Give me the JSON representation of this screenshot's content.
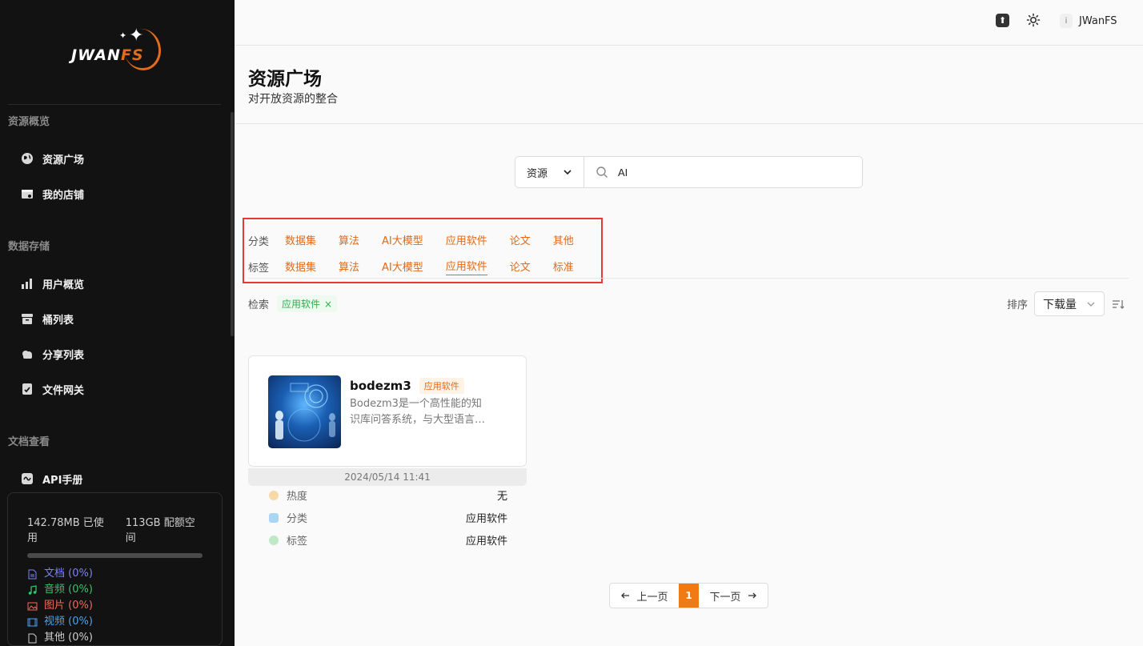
{
  "brand": {
    "logo_main": "JWAN",
    "logo_accent": "FS"
  },
  "sidebar": {
    "sections": [
      {
        "title": "资源概览",
        "items": [
          {
            "label": "资源广场",
            "icon": "globe-icon"
          },
          {
            "label": "我的店铺",
            "icon": "store-icon"
          }
        ]
      },
      {
        "title": "数据存储",
        "items": [
          {
            "label": "用户概览",
            "icon": "bar-chart-icon"
          },
          {
            "label": "桶列表",
            "icon": "archive-icon"
          },
          {
            "label": "分享列表",
            "icon": "cloud-icon"
          },
          {
            "label": "文件网关",
            "icon": "shield-check-icon"
          }
        ]
      },
      {
        "title": "文档查看",
        "items": [
          {
            "label": "API手册",
            "icon": "api-icon"
          }
        ]
      }
    ],
    "storage": {
      "used": "142.78MB 已使用",
      "quota": "113GB 配额空间",
      "used_fraction": 0.0,
      "types": [
        {
          "label": "文档 (0%)",
          "color": "#7b84f0",
          "icon": "document-icon"
        },
        {
          "label": "音频 (0%)",
          "color": "#35c46a",
          "icon": "music-icon"
        },
        {
          "label": "图片 (0%)",
          "color": "#f06a5a",
          "icon": "image-icon"
        },
        {
          "label": "视频 (0%)",
          "color": "#4aa3f0",
          "icon": "video-icon"
        },
        {
          "label": "其他 (0%)",
          "color": "#cfcfcf",
          "icon": "file-icon"
        }
      ]
    }
  },
  "topbar": {
    "user_initial": "i",
    "username": "JWanFS"
  },
  "page": {
    "title": "资源广场",
    "subtitle": "对开放资源的整合"
  },
  "search": {
    "type_label": "资源",
    "value": "AI",
    "placeholder": ""
  },
  "filters": {
    "category": {
      "label": "分类",
      "options": [
        "数据集",
        "算法",
        "AI大模型",
        "应用软件",
        "论文",
        "其他"
      ]
    },
    "tag": {
      "label": "标签",
      "options": [
        "数据集",
        "算法",
        "AI大模型",
        "应用软件",
        "论文",
        "标准"
      ],
      "active_index": 3
    }
  },
  "active_search": {
    "label": "检索",
    "chip": "应用软件",
    "chip_close": "×"
  },
  "sort": {
    "label": "排序",
    "value": "下载量"
  },
  "card": {
    "name": "bodezm3",
    "badge": "应用软件",
    "desc_line1": "Bodezm3是一个高性能的知",
    "desc_line2": "识库问答系统，与大型语言…",
    "date": "2024/05/14 11:41",
    "meta": [
      {
        "label": "热度",
        "value": "无",
        "color": "#f7d9a8"
      },
      {
        "label": "分类",
        "value": "应用软件",
        "color": "#a9d6f5"
      },
      {
        "label": "标签",
        "value": "应用软件",
        "color": "#bfe8c6"
      }
    ]
  },
  "pagination": {
    "prev": "上一页",
    "current": "1",
    "next": "下一页"
  },
  "colors": {
    "accent": "#e06a1a",
    "sidebar_bg": "#121212",
    "highlight_box": "#e53935"
  }
}
